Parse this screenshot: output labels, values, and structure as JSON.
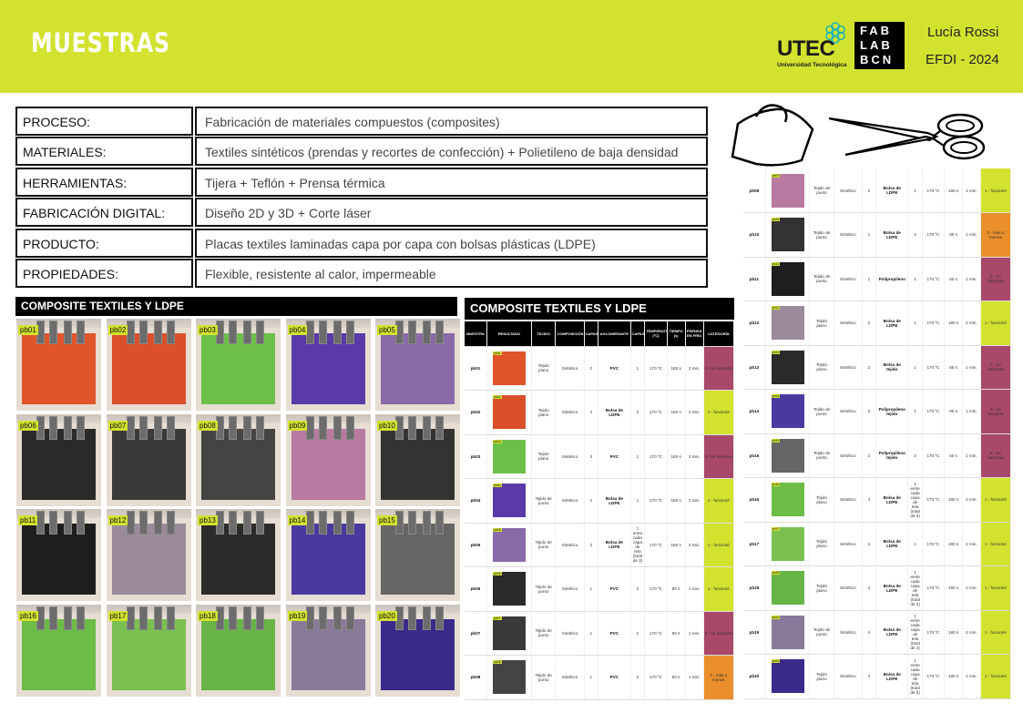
{
  "header": {
    "title": "MUESTRAS",
    "utec_word": "UTEC",
    "utec_sub": "Universidad Tecnológica",
    "fablab_lines": [
      "FAB",
      "LAB",
      "BCN"
    ],
    "author": "Lucía Rossi",
    "event": "EFDI - 2024",
    "bg_color": "#d2e22f"
  },
  "info": [
    {
      "label": "PROCESO:",
      "value": "Fabricación de materiales compuestos (composites)"
    },
    {
      "label": "MATERIALES:",
      "value": "Textiles sintéticos (prendas y recortes de confección) + Polietileno de baja densidad"
    },
    {
      "label": "HERRAMIENTAS:",
      "value": "Tijera + Teflón + Prensa térmica"
    },
    {
      "label": "FABRICACIÓN DIGITAL:",
      "value": "Diseño 2D y 3D + Corte láser"
    },
    {
      "label": "PRODUCTO:",
      "value": "Placas textiles laminadas capa por capa con bolsas plásticas (LDPE)"
    },
    {
      "label": "PROPIEDADES:",
      "value": "Flexible, resistente al calor, impermeable"
    }
  ],
  "gallery_title": "COMPOSITE TEXTILES Y LDPE",
  "table_title": "COMPOSITE TEXTILES Y LDPE",
  "table_headers": [
    "MUESTRA",
    "RESULTADO",
    "TEJIDO",
    "COMPOSICIÓN",
    "CAPAS",
    "AGLOMERANTE",
    "CAPAS",
    "TEMPERATURA (ºC)",
    "TIEMPO (s)",
    "PRENSA EN FRÍO",
    "CATEGORÍA"
  ],
  "category_colors": {
    "funciona": "#d2e22f",
    "mas_o_menos": "#ea8f2b",
    "no_funciona": "#a8486b"
  },
  "samples": [
    {
      "id": "pb01",
      "tejido": "Tejido plano",
      "comp": "Sintético",
      "capas": "2",
      "aglo": "PVC",
      "capas_aglo": "1",
      "temp": "170 ºC",
      "tiempo": "180 s",
      "prensa": "2 min.",
      "cat": "3 - no funciona",
      "cat_key": "no_funciona",
      "color": "#e0552a"
    },
    {
      "id": "pb02",
      "tejido": "Tejido plano",
      "comp": "Sintético",
      "capas": "2",
      "aglo": "Bolsa de LDPE",
      "capas_aglo": "2",
      "temp": "170 ºC",
      "tiempo": "180 s",
      "prensa": "2 min.",
      "cat": "1 - funcioné",
      "cat_key": "funciona",
      "color": "#d9502a"
    },
    {
      "id": "pb03",
      "tejido": "Tejido plano",
      "comp": "Sintético",
      "capas": "3",
      "aglo": "PVC",
      "capas_aglo": "1",
      "temp": "170 ºC",
      "tiempo": "180 s",
      "prensa": "2 min.",
      "cat": "3 - no funciona",
      "cat_key": "no_funciona",
      "color": "#6cc04a"
    },
    {
      "id": "pb04",
      "tejido": "Tejido de punto",
      "comp": "Sintético",
      "capas": "2",
      "aglo": "Bolsa de LDPE",
      "capas_aglo": "1",
      "temp": "170 ºC",
      "tiempo": "180 s",
      "prensa": "2 min.",
      "cat": "1 - funcioné",
      "cat_key": "funciona",
      "color": "#5a3aa8"
    },
    {
      "id": "pb05",
      "tejido": "Tejido de punto",
      "comp": "Sintético",
      "capas": "3",
      "aglo": "Bolsa de LDPE",
      "capas_aglo": "1 entre cada capa de tela (total de 3)",
      "temp": "170 ºC",
      "tiempo": "180 s",
      "prensa": "2 min.",
      "cat": "1 - funcioné",
      "cat_key": "funciona",
      "color": "#8a6aa8"
    },
    {
      "id": "pb06",
      "tejido": "Tejido de punto",
      "comp": "Sintético",
      "capas": "1",
      "aglo": "PVC",
      "capas_aglo": "2",
      "temp": "170 ºC",
      "tiempo": "60 s",
      "prensa": "1 min.",
      "cat": "1 - funcioné",
      "cat_key": "funciona",
      "color": "#2a2a2a"
    },
    {
      "id": "pb07",
      "tejido": "Tejido de punto",
      "comp": "Sintético",
      "capas": "1",
      "aglo": "PVC",
      "capas_aglo": "2",
      "temp": "170 ºC",
      "tiempo": "60 s",
      "prensa": "1 min.",
      "cat": "3 - no funciona",
      "cat_key": "no_funciona",
      "color": "#3a3a3a"
    },
    {
      "id": "pb08",
      "tejido": "Tejido de punto",
      "comp": "Sintético",
      "capas": "1",
      "aglo": "PVC",
      "capas_aglo": "2",
      "temp": "170 ºC",
      "tiempo": "60 s",
      "prensa": "1 min.",
      "cat": "2 - más o menos",
      "cat_key": "mas_o_menos",
      "color": "#444"
    },
    {
      "id": "pb09",
      "tejido": "Tejido de punto",
      "comp": "Sintético",
      "capas": "2",
      "aglo": "Bolsa de LDPE",
      "capas_aglo": "1",
      "temp": "170 ºC",
      "tiempo": "180 s",
      "prensa": "1 min.",
      "cat": "1 - funcioné",
      "cat_key": "funciona",
      "color": "#b87aa0"
    },
    {
      "id": "pb10",
      "tejido": "Tejido de punto",
      "comp": "Sintético",
      "capas": "1",
      "aglo": "Bolsa de LDPE",
      "capas_aglo": "2",
      "temp": "170 ºC",
      "tiempo": "60 s",
      "prensa": "1 min.",
      "cat": "2 - más o menos",
      "cat_key": "mas_o_menos",
      "color": "#333"
    },
    {
      "id": "pb11",
      "tejido": "Tejido de punto",
      "comp": "Sintético",
      "capas": "1",
      "aglo": "Polipropileno",
      "capas_aglo": "1",
      "temp": "170 ºC",
      "tiempo": "60 s",
      "prensa": "1 min.",
      "cat": "3 - no funciona",
      "cat_key": "no_funciona",
      "color": "#1e1e1e"
    },
    {
      "id": "pb12",
      "tejido": "Tejido plano",
      "comp": "Sintético",
      "capas": "2",
      "aglo": "Bolsa de LDPE",
      "capas_aglo": "1",
      "temp": "170 ºC",
      "tiempo": "180 s",
      "prensa": "2 min.",
      "cat": "1 - funcioné",
      "cat_key": "funciona",
      "color": "#9a8a9a"
    },
    {
      "id": "pb13",
      "tejido": "Tejido plano",
      "comp": "Sintético",
      "capas": "2",
      "aglo": "Bolsa de tejido",
      "capas_aglo": "1",
      "temp": "170 ºC",
      "tiempo": "60 s",
      "prensa": "1 min.",
      "cat": "3 - no funciona",
      "cat_key": "no_funciona",
      "color": "#2b2b2b"
    },
    {
      "id": "pb14",
      "tejido": "Tejido de punto",
      "comp": "Sintético",
      "capas": "2",
      "aglo": "Polipropileno tejido",
      "capas_aglo": "1",
      "temp": "170 ºC",
      "tiempo": "60 s",
      "prensa": "1 min.",
      "cat": "3 - no funciona",
      "cat_key": "no_funciona",
      "color": "#4a3aa0"
    },
    {
      "id": "pb15",
      "tejido": "Tejido de punto",
      "comp": "Sintético",
      "capas": "2",
      "aglo": "Polipropileno tejido",
      "capas_aglo": "2",
      "temp": "170 ºC",
      "tiempo": "60 s",
      "prensa": "1 min.",
      "cat": "3 - no funciona",
      "cat_key": "no_funciona",
      "color": "#666"
    },
    {
      "id": "pb16",
      "tejido": "Tejido plano",
      "comp": "Sintético",
      "capas": "4",
      "aglo": "Bolsa de LDPE",
      "capas_aglo": "1 entre cada capa de tela (total de 3)",
      "temp": "170 ºC",
      "tiempo": "180 s",
      "prensa": "2 min.",
      "cat": "1 - funcioné",
      "cat_key": "funciona",
      "color": "#6cbc46"
    },
    {
      "id": "pb17",
      "tejido": "Tejido plano",
      "comp": "Sintético",
      "capas": "2",
      "aglo": "Bolsa de LDPE",
      "capas_aglo": "1",
      "temp": "170 ºC",
      "tiempo": "180 s",
      "prensa": "2 min.",
      "cat": "1 - funcioné",
      "cat_key": "funciona",
      "color": "#7ac050"
    },
    {
      "id": "pb18",
      "tejido": "Tejido plano",
      "comp": "Sintético",
      "capas": "4",
      "aglo": "Bolsa de LDPE",
      "capas_aglo": "1 entre cada capa de tela (total de 3)",
      "temp": "170 ºC",
      "tiempo": "180 s",
      "prensa": "2 min.",
      "cat": "1 - funcioné",
      "cat_key": "funciona",
      "color": "#68b446"
    },
    {
      "id": "pb19",
      "tejido": "Tejido de punto",
      "comp": "Sintético",
      "capas": "4",
      "aglo": "Bolsa de LDPE",
      "capas_aglo": "1 entre cada capa de tela (total de 3)",
      "temp": "170 ºC",
      "tiempo": "180 s",
      "prensa": "2 min.",
      "cat": "1 - funcioné",
      "cat_key": "funciona",
      "color": "#8a7a9a"
    },
    {
      "id": "pb20",
      "tejido": "Tejido plano",
      "comp": "Sintético",
      "capas": "4",
      "aglo": "Bolsa de LDPE",
      "capas_aglo": "1 entre cada capa de tela (total de 3)",
      "temp": "170 ºC",
      "tiempo": "180 s",
      "prensa": "2 min.",
      "cat": "1 - funcioné",
      "cat_key": "funciona",
      "color": "#3a2a8a"
    }
  ]
}
